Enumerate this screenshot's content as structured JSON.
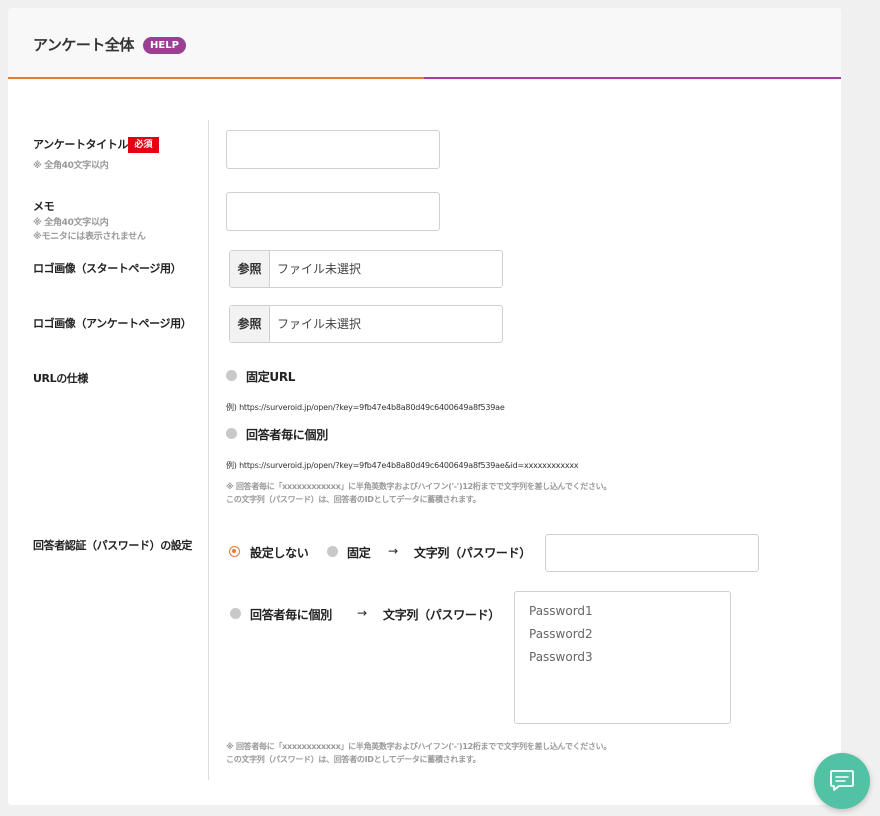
{
  "header": {
    "title": "アンケート全体",
    "help_label": "HELP"
  },
  "fields": {
    "title": {
      "label": "アンケートタイトル",
      "required_badge": "必須",
      "note": "※ 全角40文字以内",
      "value": ""
    },
    "memo": {
      "label": "メモ",
      "note1": "※ 全角40文字以内",
      "note2": "※モニタには表示されません",
      "value": ""
    },
    "logo_start": {
      "label": "ロゴ画像（スタートページ用）",
      "button": "参照",
      "status": "ファイル未選択"
    },
    "logo_survey": {
      "label": "ロゴ画像（アンケートページ用）",
      "button": "参照",
      "status": "ファイル未選択"
    },
    "url_spec": {
      "label": "URLの仕様",
      "option_fixed": "固定URL",
      "example_fixed": "例) https://surveroid.jp/open/?key=9fb47e4b8a80d49c6400649a8f539ae",
      "option_individual": "回答者毎に個別",
      "example_individual": "例) https://surveroid.jp/open/?key=9fb47e4b8a80d49c6400649a8f539ae&id=xxxxxxxxxxxx",
      "note1": "※ 回答者毎に「xxxxxxxxxxxx」に半角英数字およびハイフン('-')12桁までで文字列を差し込んでください。",
      "note2": "この文字列（パスワード）は、回答者のIDとしてデータに蓄積されます。"
    },
    "auth": {
      "label": "回答者認証（パスワード）の設定",
      "option_none": "設定しない",
      "option_fixed": "固定",
      "arrow": "→",
      "string_label": "文字列（パスワード）",
      "option_individual": "回答者毎に個別",
      "fixed_value": "",
      "passwords": "Password1\nPassword2\nPassword3",
      "note1": "※ 回答者毎に「xxxxxxxxxxxx」に半角英数字およびハイフン('-')12桁までで文字列を差し込んでください。",
      "note2": "この文字列（パスワード）は、回答者のIDとしてデータに蓄積されます。"
    }
  },
  "colors": {
    "accent_orange": "#e37b34",
    "accent_purple": "#a0449b",
    "help_badge": "#9b3f93",
    "required_badge": "#e60012",
    "chat_button": "#52c2a5"
  },
  "icons": {
    "chat": "chat-bubble-icon"
  }
}
